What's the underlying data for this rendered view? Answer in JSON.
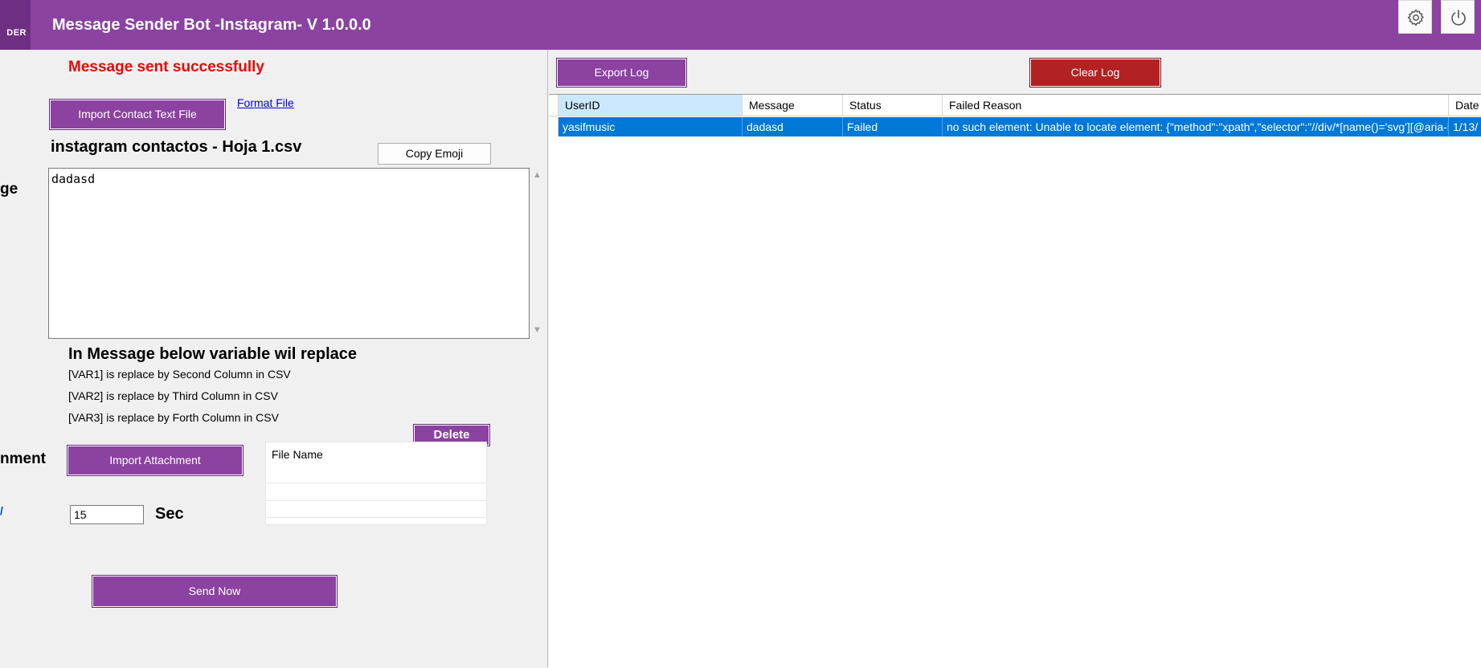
{
  "app": {
    "logo_text": "DER",
    "title": "Message Sender Bot -Instagram- V 1.0.0.0"
  },
  "left": {
    "status_message": "Message sent successfully",
    "import_contact_label": "Import Contact Text File",
    "format_file_link": "Format File",
    "loaded_file": "instagram contactos - Hoja 1.csv",
    "copy_emoji_label": "Copy Emoji",
    "message_label": "ge",
    "message_text": "dadasd",
    "variables_heading": "In Message below variable wil replace",
    "variables": [
      "[VAR1] is replace by Second Column in CSV",
      "[VAR2] is replace by Third Column in CSV",
      "[VAR3] is replace by Forth Column in CSV"
    ],
    "delete_label": "Delete",
    "attachment_label": "nment",
    "import_attachment_label": "Import Attachment",
    "file_list_header": "File Name",
    "delay_label": "/",
    "delay_value": "15",
    "delay_unit": "Sec",
    "send_now_label": "Send Now"
  },
  "log": {
    "export_label": "Export Log",
    "clear_label": "Clear Log",
    "columns": [
      "UserID",
      "Message",
      "Status",
      "Failed Reason",
      "Date"
    ],
    "rows": [
      {
        "userid": "yasifmusic",
        "message": "dadasd",
        "status": "Failed",
        "failed_reason": "no such element: Unable to locate element: {\"method\":\"xpath\",\"selector\":\"//div/*[name()='svg'][@aria-l...",
        "date": "1/13/"
      }
    ]
  },
  "colors": {
    "brand_purple": "#8b42a1",
    "status_red": "#e60a0a",
    "clear_log_red": "#b22222",
    "selection_blue": "#0078d7"
  },
  "icons": {
    "settings": "gear-icon",
    "power": "power-icon"
  }
}
